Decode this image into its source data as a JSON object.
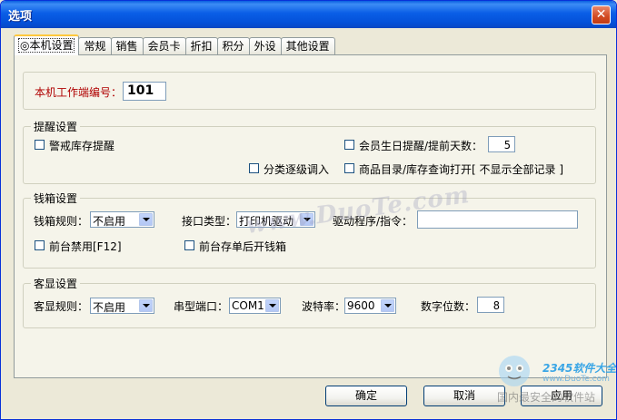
{
  "window": {
    "title": "选项",
    "close_icon": "close-icon"
  },
  "tabs": [
    {
      "label": "◎本机设置",
      "active": true
    },
    {
      "label": "常规"
    },
    {
      "label": "销售"
    },
    {
      "label": "会员卡"
    },
    {
      "label": "折扣"
    },
    {
      "label": "积分"
    },
    {
      "label": "外设"
    },
    {
      "label": "其他设置"
    }
  ],
  "terminal": {
    "label": "本机工作端编号：",
    "value": "101"
  },
  "reminder": {
    "title": "提醒设置",
    "stock_warning": {
      "label": "警戒库存提醒",
      "checked": false
    },
    "member_birthday": {
      "label": "会员生日提醒/提前天数：",
      "checked": false
    },
    "birthday_days": "5",
    "category_load": {
      "label": "分类逐级调入",
      "checked": false
    },
    "catalog_open": {
      "label": "商品目录/库存查询打开[ 不显示全部记录 ]",
      "checked": false
    }
  },
  "cashbox": {
    "title": "钱箱设置",
    "rule_label": "钱箱规则：",
    "rule_value": "不启用",
    "interface_label": "接口类型：",
    "interface_value": "打印机驱动",
    "driver_label": "驱动程序/指令：",
    "driver_value": "",
    "disable_front": {
      "label": "前台禁用[F12]",
      "checked": false
    },
    "open_after_save": {
      "label": "前台存单后开钱箱",
      "checked": false
    }
  },
  "display": {
    "title": "客显设置",
    "rule_label": "客显规则：",
    "rule_value": "不启用",
    "port_label": "串型端口：",
    "port_value": "COM1",
    "baud_label": "波特率：",
    "baud_value": "9600",
    "digits_label": "数字位数：",
    "digits_value": "8"
  },
  "buttons": {
    "ok": "确定",
    "cancel": "取消",
    "apply": "应用"
  },
  "watermark": {
    "text": "www.DuoTe.com",
    "brand": "2345软件大全",
    "url": "www.DuoTe.com",
    "sub": "国内最安全的软件站"
  }
}
